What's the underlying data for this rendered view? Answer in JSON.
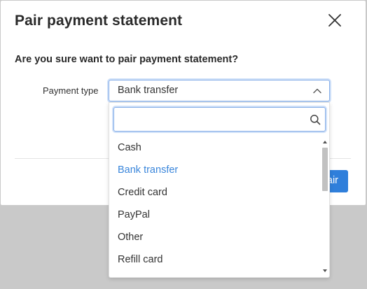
{
  "dialog": {
    "title": "Pair payment statement",
    "question": "Are you sure want to pair payment statement?",
    "pair_button_label": "Pair"
  },
  "payment_type": {
    "label": "Payment type",
    "selected": "Bank transfer",
    "search_placeholder": "",
    "options": [
      "Cash",
      "Bank transfer",
      "Credit card",
      "PayPal",
      "Other",
      "Refill card"
    ],
    "selected_index": 1
  },
  "colors": {
    "accent": "#2f7fdb",
    "selected_option": "#3a86db",
    "focus_border": "#86aee8"
  },
  "icons": {
    "close": "close-icon",
    "chevron": "chevron-up-icon",
    "search": "search-icon"
  }
}
